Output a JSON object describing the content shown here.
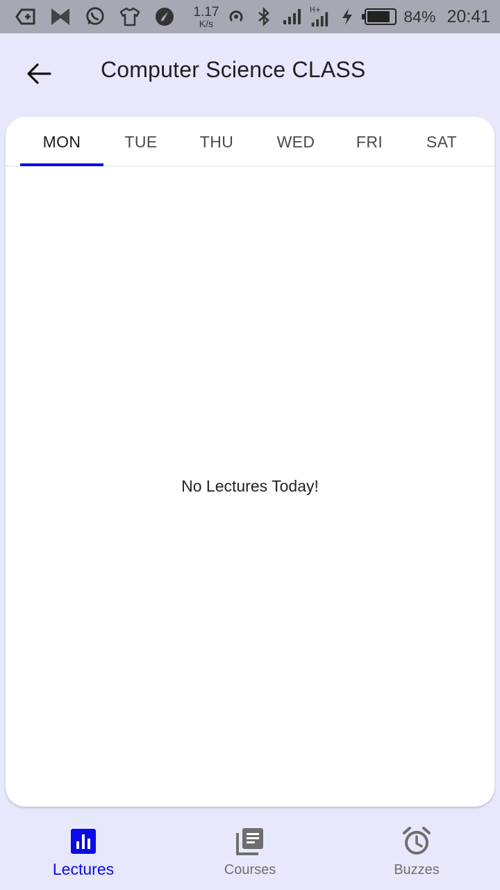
{
  "status_bar": {
    "speed_value": "1.17",
    "speed_unit": "K/s",
    "battery_percent": "84%",
    "battery_level": 0.84,
    "time": "20:41",
    "icons": [
      "keyboard-icon",
      "app-icon",
      "whatsapp-icon",
      "shirt-icon",
      "compass-icon",
      "hotspot-icon",
      "bluetooth-icon",
      "signal-icon",
      "signal-hplus-icon",
      "charging-icon",
      "battery-icon"
    ]
  },
  "app_bar": {
    "back_icon": "arrow-back-icon",
    "title": "Computer Science CLASS"
  },
  "tabs": [
    {
      "label": "MON",
      "active": true
    },
    {
      "label": "TUE",
      "active": false
    },
    {
      "label": "THU",
      "active": false
    },
    {
      "label": "WED",
      "active": false
    },
    {
      "label": "FRI",
      "active": false
    },
    {
      "label": "SAT",
      "active": false
    }
  ],
  "content": {
    "empty_message": "No Lectures Today!"
  },
  "bottom_nav": [
    {
      "label": "Lectures",
      "icon": "bar-chart-icon",
      "active": true
    },
    {
      "label": "Courses",
      "icon": "library-books-icon",
      "active": false
    },
    {
      "label": "Buzzes",
      "icon": "alarm-icon",
      "active": false
    }
  ],
  "colors": {
    "accent": "#0a0ae8",
    "background": "#e8e8fd",
    "card": "#ffffff",
    "status_bar": "#a8a8b4"
  }
}
